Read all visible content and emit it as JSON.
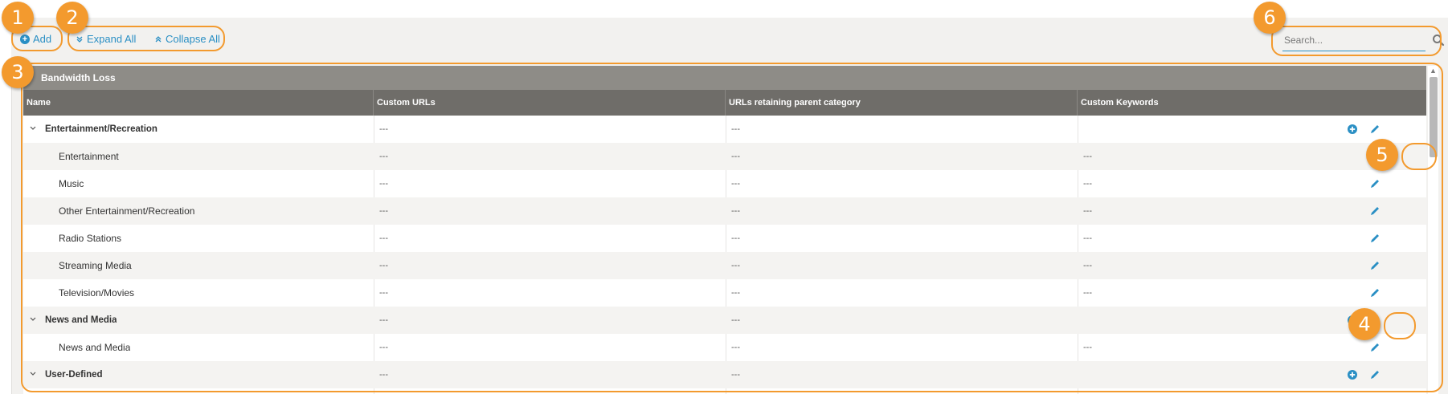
{
  "toolbar": {
    "add_label": "Add",
    "expand_all_label": "Expand All",
    "collapse_all_label": "Collapse All"
  },
  "search": {
    "placeholder": "Search..."
  },
  "table": {
    "group_title": "Bandwidth Loss",
    "columns": [
      "Name",
      "Custom URLs",
      "URLs retaining parent category",
      "Custom Keywords"
    ],
    "rows": [
      {
        "name": "Entertainment/Recreation",
        "custom_urls": "---",
        "urls_retaining": "---",
        "custom_keywords": ""
      },
      {
        "name": "Entertainment",
        "custom_urls": "---",
        "urls_retaining": "---",
        "custom_keywords": "---"
      },
      {
        "name": "Music",
        "custom_urls": "---",
        "urls_retaining": "---",
        "custom_keywords": "---"
      },
      {
        "name": "Other Entertainment/Recreation",
        "custom_urls": "---",
        "urls_retaining": "---",
        "custom_keywords": "---"
      },
      {
        "name": "Radio Stations",
        "custom_urls": "---",
        "urls_retaining": "---",
        "custom_keywords": "---"
      },
      {
        "name": "Streaming Media",
        "custom_urls": "---",
        "urls_retaining": "---",
        "custom_keywords": "---"
      },
      {
        "name": "Television/Movies",
        "custom_urls": "---",
        "urls_retaining": "---",
        "custom_keywords": "---"
      },
      {
        "name": "News and Media",
        "custom_urls": "---",
        "urls_retaining": "---",
        "custom_keywords": ""
      },
      {
        "name": "News and Media",
        "custom_urls": "---",
        "urls_retaining": "---",
        "custom_keywords": "---"
      },
      {
        "name": "User-Defined",
        "custom_urls": "---",
        "urls_retaining": "---",
        "custom_keywords": ""
      }
    ]
  },
  "callouts": [
    "1",
    "2",
    "3",
    "4",
    "5",
    "6"
  ],
  "icons": {
    "add": "plus-circle-icon",
    "edit": "pencil-icon",
    "expand": "double-chevron-down-icon",
    "collapse": "double-chevron-up-icon",
    "search": "magnifier-icon",
    "caret": "chevron-down-icon"
  },
  "colors": {
    "accent": "#2a8fc4",
    "callout": "#f39a2e",
    "group_header": "#8e8c87",
    "column_header": "#6f6d69",
    "toolbar_bg": "#f2f1ef"
  }
}
